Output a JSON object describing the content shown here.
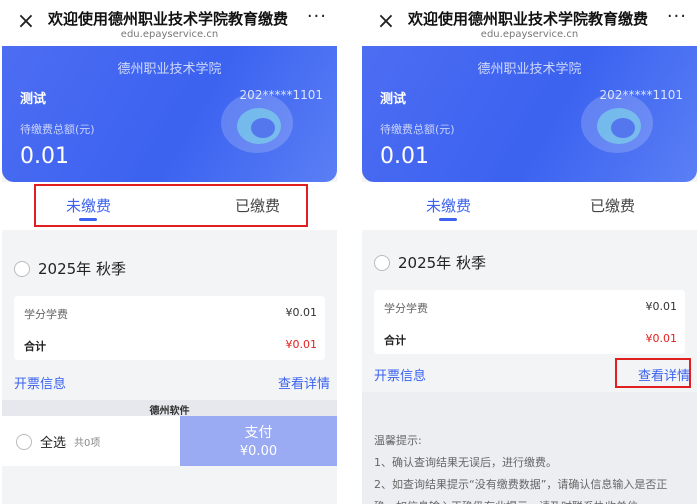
{
  "left": {
    "topbar": {
      "close": "×",
      "title": "欢迎使用德州职业技术学院教育缴费",
      "url": "edu.epayservice.cn",
      "more": "···"
    },
    "card": {
      "school": "德州职业技术学院",
      "name": "测试",
      "student_id": "202*****1101",
      "pending_label": "待缴费总额(元)",
      "amount": "0.01"
    },
    "tabs": {
      "unpaid": "未缴费",
      "paid": "已缴费"
    },
    "period": "2025年  秋季",
    "fee": {
      "item": "学分学费",
      "item_amount": "¥0.01",
      "total_label": "合计",
      "total_amount": "¥0.01"
    },
    "links": {
      "invoice": "开票信息",
      "details": "查看详情"
    },
    "bottom": {
      "select_all": "全选",
      "count": "共0项",
      "pay": "支付",
      "pay_amount": "¥0.00"
    },
    "hidden_text": "德州软件"
  },
  "right": {
    "topbar": {
      "close": "×",
      "title": "欢迎使用德州职业技术学院教育缴费",
      "url": "edu.epayservice.cn",
      "more": "···"
    },
    "card": {
      "school": "德州职业技术学院",
      "name": "测试",
      "student_id": "202*****1101",
      "pending_label": "待缴费总额(元)",
      "amount": "0.01"
    },
    "tabs": {
      "unpaid": "未缴费",
      "paid": "已缴费"
    },
    "period": "2025年  秋季",
    "fee": {
      "item": "学分学费",
      "item_amount": "¥0.01",
      "total_label": "合计",
      "total_amount": "¥0.01"
    },
    "links": {
      "invoice": "开票信息",
      "details": "查看详情"
    },
    "tips": {
      "title": "温馨提示:",
      "line1": "1、确认查询结果无误后，进行缴费。",
      "line2": "2、如查询结果提示“没有缴费数据”，请确认信息输入是否正",
      "line3": "确，如信息输入正确仍有此提示，请及时联系执收单位。"
    }
  },
  "colors": {
    "accent": "#3b62f0",
    "highlight_box": "#e02020",
    "pay_button": "#9aaaf3"
  }
}
